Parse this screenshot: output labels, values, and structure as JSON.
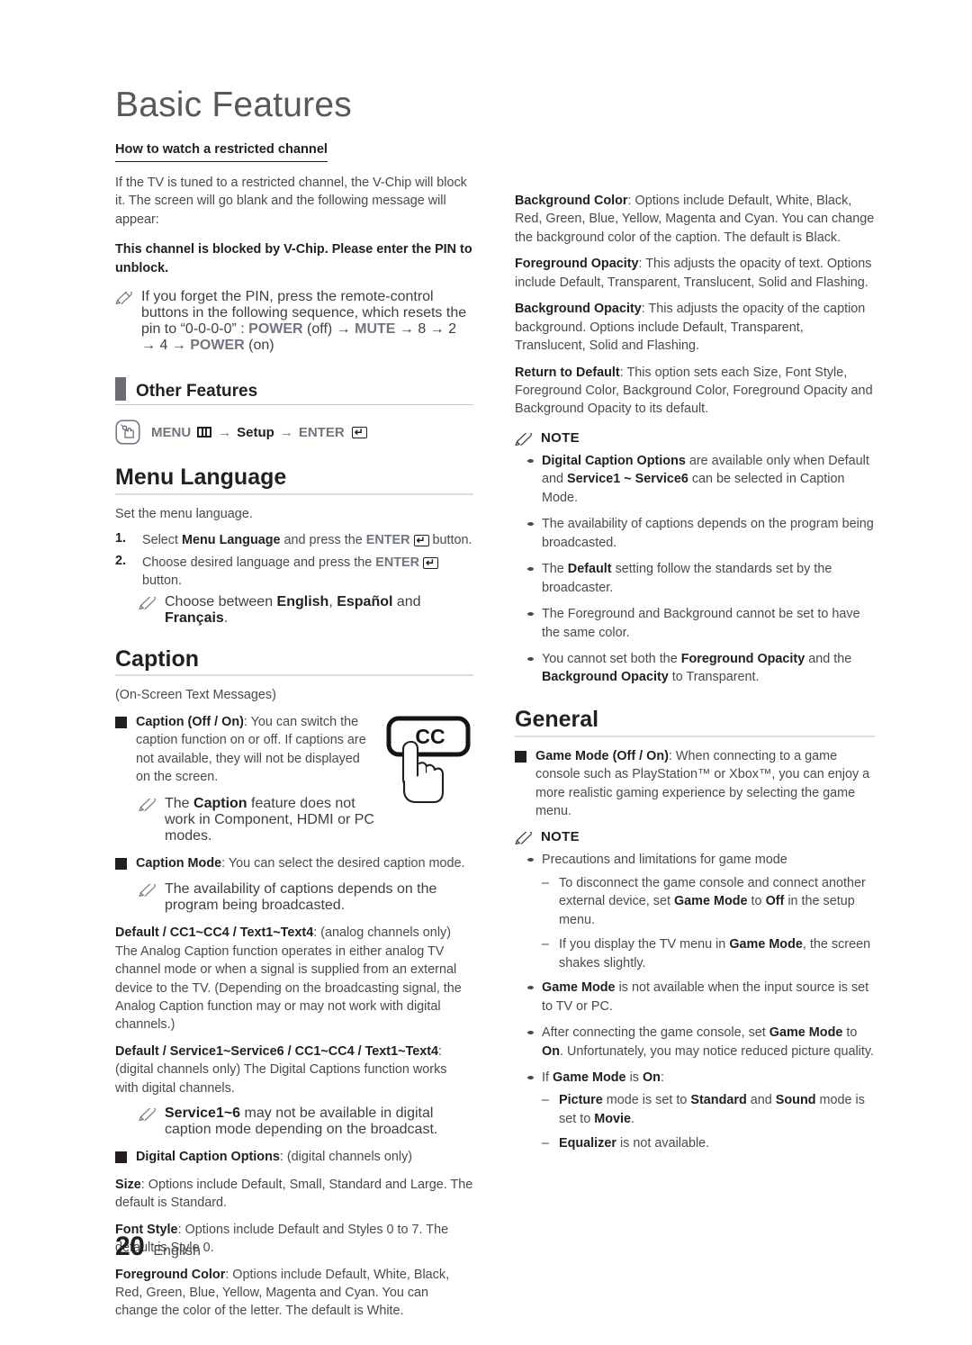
{
  "page": {
    "title": "Basic Features",
    "number": "20",
    "language": "English"
  },
  "left": {
    "restricted": {
      "heading": "How to watch a restricted channel",
      "para": "If the TV is tuned to a restricted channel, the V-Chip will block it. The screen will go blank and the following message will appear:",
      "bold_message": "This channel is blocked by V-Chip. Please enter the PIN to unblock.",
      "note": "If you forget the PIN, press the remote-control buttons in the following sequence, which resets the pin to “0-0-0-0” : POWER (off) → MUTE → 8 → 2 → 4 → POWER (on)",
      "note_parts": {
        "p1": "If you forget the PIN, press the remote-control buttons in the following sequence, which resets the pin to “0-0-0-0” : ",
        "power_off": "POWER",
        "off": " (off) → ",
        "mute": "MUTE",
        "seq": " → 8 → 2 → 4 → ",
        "power_on": "POWER",
        "on": " (on)"
      }
    },
    "other_features": {
      "label": "Other Features",
      "path": {
        "menu": "MENU",
        "arrow1": "→",
        "setup": "Setup",
        "arrow2": "→",
        "enter": "ENTER"
      }
    },
    "menu_language": {
      "title": "Menu Language",
      "intro": "Set the menu language.",
      "steps": [
        {
          "num": "1.",
          "pre": "Select ",
          "bold": "Menu Language",
          "mid": " and press the ",
          "enter": "ENTER",
          "post": " button."
        },
        {
          "num": "2.",
          "pre": "Choose desired language and press the ",
          "bold": "",
          "mid": "",
          "enter": "ENTER",
          "post": " button."
        }
      ],
      "note": {
        "pre": "Choose between ",
        "b1": "English",
        "sep1": ", ",
        "b2": "Español",
        "sep2": " and ",
        "b3": "Français",
        "post": "."
      }
    },
    "caption": {
      "title": "Caption",
      "subtitle": "(On-Screen Text Messages)",
      "icon_label": "CC",
      "items": [
        {
          "bold": "Caption (Off / On)",
          "text": ": You can switch the caption function on or off. If captions are not available, they will not be displayed on the screen."
        },
        {
          "bold": "Caption Mode",
          "text": ": You can select the desired caption mode."
        },
        {
          "bold": "Digital Caption Options",
          "text": ": (digital channels only)"
        }
      ],
      "note_caption_feature": {
        "pre": "The ",
        "bold": "Caption",
        "post": " feature does not work in Component, HDMI or PC modes."
      },
      "note_availability": "The availability of captions depends on the program being broadcasted.",
      "analog": {
        "bold": "Default / CC1~CC4 / Text1~Text4",
        "text": ": (analog channels only) The Analog Caption function operates in either analog TV channel mode or when a signal is supplied from an external device to the TV. (Depending on the broadcasting signal, the Analog Caption function may or may not work with digital channels.)"
      },
      "digital": {
        "bold": "Default / Service1~Service6 / CC1~CC4 / Text1~Text4",
        "text": ": (digital channels only) The Digital Captions function works with digital channels."
      },
      "note_service": {
        "bold": "Service1~6",
        "post": " may not be available in digital caption mode depending on the broadcast."
      },
      "options": [
        {
          "bold": "Size",
          "text": ": Options include Default, Small, Standard and Large. The default is Standard."
        },
        {
          "bold": "Font Style",
          "text": ": Options include Default and Styles 0 to 7. The default is Style 0."
        },
        {
          "bold": "Foreground Color",
          "text": ": Options include Default, White, Black, Red, Green, Blue, Yellow, Magenta and Cyan. You can change the color of the letter. The default is White."
        }
      ]
    }
  },
  "right": {
    "caption_options_cont": [
      {
        "bold": "Background Color",
        "text": ": Options include Default, White, Black, Red, Green, Blue, Yellow, Magenta and Cyan. You can change the background color of the caption. The default is Black."
      },
      {
        "bold": "Foreground Opacity",
        "text": ": This adjusts the opacity of text. Options include Default, Transparent, Translucent, Solid and Flashing."
      },
      {
        "bold": "Background Opacity",
        "text": ": This adjusts the opacity of the caption background. Options include Default, Transparent, Translucent, Solid and Flashing."
      },
      {
        "bold": "Return to Default",
        "text": ": This option sets each Size, Font Style, Foreground Color, Background Color, Foreground Opacity and Background Opacity to its default."
      }
    ],
    "note_caption": {
      "title": "NOTE",
      "items": [
        {
          "b1": "Digital Caption Options",
          "t1": " are available only when Default and ",
          "b2": "Service1 ~ Service6",
          "t2": " can be selected in Caption Mode."
        },
        {
          "b1": "",
          "t1": "The availability of captions depends on the program being broadcasted.",
          "b2": "",
          "t2": ""
        },
        {
          "b1": "",
          "t1": "The ",
          "b2": "Default",
          "t2": " setting follow the standards set by the broadcaster."
        },
        {
          "b1": "",
          "t1": "The Foreground and Background cannot be set to have the same color.",
          "b2": "",
          "t2": ""
        },
        {
          "b1": "",
          "t1": "You cannot set both the ",
          "b2": "Foreground Opacity",
          "t2": " and the ",
          "b3": "Background Opacity",
          "t3": " to Transparent."
        }
      ]
    },
    "general": {
      "title": "General",
      "game_mode": {
        "bold": "Game Mode (Off / On)",
        "text": ": When connecting to a game console such as PlayStation™ or Xbox™, you can enjoy a more realistic gaming experience by selecting the game menu."
      },
      "note": {
        "title": "NOTE",
        "precautions": "Precautions and limitations for game mode",
        "dashes": [
          {
            "t1": "To disconnect the game console and connect another external device, set ",
            "b1": "Game Mode",
            "t2": " to ",
            "b2": "Off",
            "t3": " in the setup menu."
          },
          {
            "t1": "If you display the TV menu in ",
            "b1": "Game Mode",
            "t2": ", the screen shakes slightly.",
            "b2": "",
            "t3": ""
          }
        ],
        "bullets": [
          {
            "b1": "Game Mode",
            "t1": " is not available when the input source is set to TV or PC.",
            "b2": "",
            "t2": ""
          },
          {
            "b1": "",
            "t1": "After connecting the game console, set ",
            "b2": "Game Mode",
            "t2": " to ",
            "b3": "On",
            "t3": ". Unfortunately, you may notice reduced picture quality."
          },
          {
            "b1": "",
            "t1": "If ",
            "b2": "Game Mode",
            "t2": " is ",
            "b3": "On",
            "t3": ":"
          }
        ],
        "sub_dashes": [
          {
            "b1": "Picture",
            "t1": " mode is set to ",
            "b2": "Standard",
            "t2": " and ",
            "b3": "Sound",
            "t3": " mode is set to ",
            "b4": "Movie",
            "t4": "."
          },
          {
            "b1": "Equalizer",
            "t1": " is not available.",
            "b2": "",
            "t2": "",
            "b3": "",
            "t3": "",
            "b4": "",
            "t4": ""
          }
        ]
      }
    }
  },
  "colors": {
    "heading": "#231f20",
    "body": "#4a4a4d",
    "accent_gray": "#6c6c74",
    "path_blue_gray": "#6f7680",
    "rule": "#dcdcdf"
  }
}
